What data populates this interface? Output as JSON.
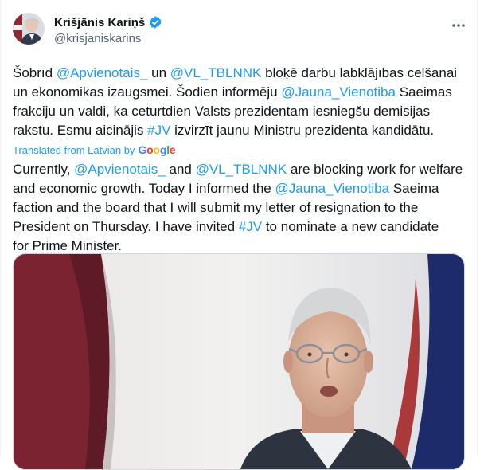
{
  "author": {
    "display_name": "Krišjānis Kariņš",
    "handle": "@krisjaniskarins",
    "verified": true
  },
  "icons": {
    "verified": "verified-badge-icon",
    "more": "more-options-icon"
  },
  "tweet": {
    "original_lines": [
      [
        {
          "t": "Šobrīd ",
          "k": "text"
        },
        {
          "t": "@Apvienotais_",
          "k": "mention"
        },
        {
          "t": "  un ",
          "k": "text"
        },
        {
          "t": "@VL_TBLNNK",
          "k": "mention"
        },
        {
          "t": " bloķē darbu labklājības celšanai",
          "k": "text"
        }
      ],
      [
        {
          "t": "un ekonomikas izaugsmei. Šodien informēju ",
          "k": "text"
        },
        {
          "t": "@Jauna_Vienotiba",
          "k": "mention"
        },
        {
          "t": " Saeimas",
          "k": "text"
        }
      ],
      [
        {
          "t": "frakciju un valdi, ka ceturtdien Valsts prezidentam iesniegšu demisijas",
          "k": "text"
        }
      ],
      [
        {
          "t": "rakstu. Esmu aicinājis ",
          "k": "text"
        },
        {
          "t": "#JV",
          "k": "hashtag"
        },
        {
          "t": " izvirzīt jaunu Ministru prezidenta kandidātu.",
          "k": "text"
        }
      ]
    ],
    "translated_label": "Translated from Latvian by",
    "google_letters": [
      {
        "c": "G",
        "color": "#4285f4"
      },
      {
        "c": "o",
        "color": "#ea4335"
      },
      {
        "c": "o",
        "color": "#fbbc05"
      },
      {
        "c": "g",
        "color": "#4285f4"
      },
      {
        "c": "l",
        "color": "#34a853"
      },
      {
        "c": "e",
        "color": "#ea4335"
      }
    ],
    "translated_lines": [
      [
        {
          "t": "Currently, ",
          "k": "text"
        },
        {
          "t": "@Apvienotais_",
          "k": "mention"
        },
        {
          "t": " and ",
          "k": "text"
        },
        {
          "t": "@VL_TBLNNK",
          "k": "mention"
        },
        {
          "t": " are blocking work for welfare",
          "k": "text"
        }
      ],
      [
        {
          "t": "and economic growth. Today I informed the ",
          "k": "text"
        },
        {
          "t": "@Jauna_Vienotiba",
          "k": "mention"
        },
        {
          "t": " Saeima",
          "k": "text"
        }
      ],
      [
        {
          "t": "faction and the board that I will submit my letter of resignation to the",
          "k": "text"
        }
      ],
      [
        {
          "t": "President on Thursday. I have invited ",
          "k": "text"
        },
        {
          "t": "#JV",
          "k": "hashtag"
        },
        {
          "t": " to nominate a new candidate",
          "k": "text"
        }
      ],
      [
        {
          "t": "for Prime Minister.",
          "k": "text"
        }
      ]
    ]
  },
  "colors": {
    "accent": "#1d9bf0",
    "text": "#0f1419",
    "secondary": "#536471"
  }
}
